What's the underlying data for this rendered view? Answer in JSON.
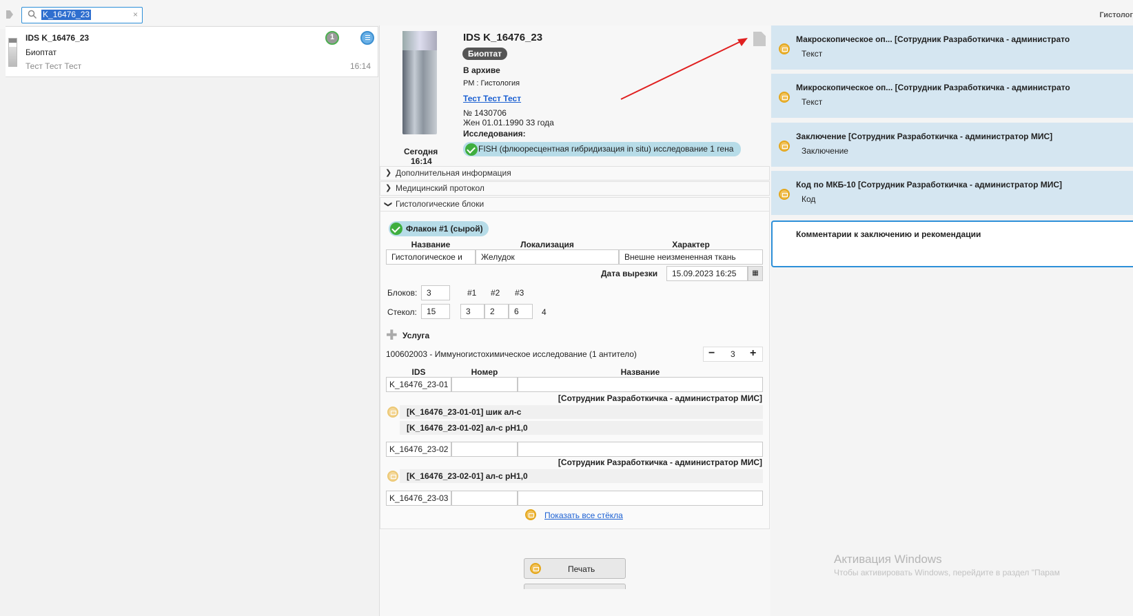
{
  "topbar": {
    "search_value": "K_16476_23",
    "clear": "×",
    "right_title": "Гистолог"
  },
  "list": {
    "item": {
      "title": "IDS K_16476_23",
      "type": "Биоптат",
      "patient": "Тест Тест Тест",
      "time": "16:14",
      "badge": "1"
    }
  },
  "detail": {
    "title": "IDS K_16476_23",
    "type_badge": "Биоптат",
    "status": "В архиве",
    "rm": "РМ : Гистология",
    "patient_link": "Тест Тест Тест",
    "number": "№ 1430706",
    "birth": "Жен 01.01.1990 33 года",
    "studies_label": "Исследования:",
    "study": "FISH (флюоресцентная гибридизация in situ) исследование 1 гена",
    "date_label": "Сегодня",
    "time_label": "16:14"
  },
  "sections": {
    "extra": "Дополнительная информация",
    "protocol": "Медицинский протокол",
    "blocks": "Гистологические блоки"
  },
  "flask": {
    "label": "Флакон #1 (сырой)",
    "headers": {
      "name": "Название",
      "loc": "Локализация",
      "char": "Характер"
    },
    "name": "Гистологическое и",
    "loc": "Желудок",
    "char": "Внешне неизмененная ткань",
    "cut_label": "Дата вырезки",
    "cut_date": "15.09.2023 16:25",
    "blocks_label": "Блоков:",
    "blocks": "3",
    "glass_label": "Стекол:",
    "glass": "15",
    "cols": [
      "#1",
      "#2",
      "#3"
    ],
    "glass_vals": [
      "3",
      "2",
      "6"
    ],
    "extra": "4",
    "service_label": "Услуга",
    "service": "100602003 - Иммуногистохимическое исследование (1 антитело)",
    "qty": "3",
    "minus": "−",
    "plus": "+",
    "table_headers": {
      "ids": "IDS",
      "num": "Номер",
      "name": "Название"
    },
    "rows": [
      {
        "ids": "K_16476_23-01",
        "staff": "[Сотрудник Разработкичка - администратор МИС]",
        "items": [
          "[K_16476_23-01-01] шик ал-с",
          "[K_16476_23-01-02] ал-с рН1,0"
        ]
      },
      {
        "ids": "K_16476_23-02",
        "staff": "[Сотрудник Разработкичка - администратор МИС]",
        "items": [
          "[K_16476_23-02-01] ал-с рН1,0"
        ]
      },
      {
        "ids": "K_16476_23-03"
      }
    ],
    "show_all": "Показать все стёкла"
  },
  "print_label": "Печать",
  "right": {
    "cards": [
      {
        "title": "Макроскопическое оп...   [Сотрудник Разработкичка - администрато",
        "sub": "Текст"
      },
      {
        "title": "Микроскопическое оп...   [Сотрудник Разработкичка - администрато",
        "sub": "Текст"
      },
      {
        "title": "Заключение [Сотрудник Разработкичка - администратор МИС]",
        "sub": "Заключение"
      },
      {
        "title": "Код по МКБ-10 [Сотрудник Разработкичка - администратор МИС]",
        "sub": "Код"
      }
    ],
    "comment": "Комментарии к заключению и рекомендации"
  },
  "watermark": {
    "title": "Активация Windows",
    "sub": "Чтобы активировать Windows, перейдите в раздел \"Парам"
  },
  "colors": {
    "accent": "#2c8fd8",
    "arrow": "#e02020",
    "card": "#d5e6f1",
    "check": "#3fae3f"
  }
}
